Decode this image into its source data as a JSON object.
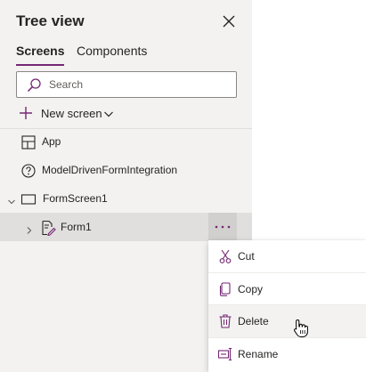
{
  "panel": {
    "title": "Tree view",
    "close_icon": "close-icon"
  },
  "tabs": [
    {
      "label": "Screens",
      "active": true
    },
    {
      "label": "Components",
      "active": false
    }
  ],
  "search": {
    "value": "",
    "placeholder": "Search",
    "icon": "search-icon"
  },
  "new_screen": {
    "label": "New screen",
    "icon": "plus-icon",
    "dropdown_icon": "chevron-down-icon"
  },
  "tree": {
    "app": {
      "label": "App",
      "icon": "app-icon"
    },
    "model_driven": {
      "label": "ModelDrivenFormIntegration",
      "icon": "help-circle-icon"
    },
    "form_screen": {
      "label": "FormScreen1",
      "icon": "screen-icon",
      "expanded": true
    },
    "form1": {
      "label": "Form1",
      "icon": "edit-form-icon",
      "selected": true,
      "more_icon": "more-horizontal-icon"
    }
  },
  "context_menu": {
    "items": [
      {
        "label": "Cut",
        "icon": "scissors-icon"
      },
      {
        "label": "Copy",
        "icon": "copy-icon"
      },
      {
        "label": "Delete",
        "icon": "trash-icon",
        "hovered": true
      },
      {
        "label": "Rename",
        "icon": "rename-icon"
      }
    ]
  },
  "colors": {
    "accent": "#742774",
    "panel_bg": "#f3f2f1",
    "selected_bg": "#e1dfdd",
    "text": "#252423"
  }
}
